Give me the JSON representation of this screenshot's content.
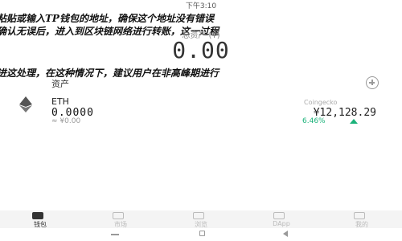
{
  "status_bar": {
    "time": "下午3:10"
  },
  "overlay_texts": [
    "粘贴或输入TP钱包的地址，确保这个地址没有错误",
    "确认无误后，进入到区块链网络进行转账，这一过程",
    "进这处理，在这种情况下，建议用户在非高峰期进行"
  ],
  "wallet": {
    "total_label": "总资产 (¥)",
    "total_amount": "0.00"
  },
  "assets": {
    "tab_label": "资产",
    "items": [
      {
        "symbol": "ETH",
        "amount": "0.0000",
        "value": "≈ ¥0.00",
        "source": "Coingecko",
        "price": "¥12,128.29",
        "change": "6.46%"
      }
    ]
  },
  "bottom_nav": [
    {
      "label": "钱包",
      "active": true
    },
    {
      "label": "市场",
      "active": false
    },
    {
      "label": "浏览",
      "active": false
    },
    {
      "label": "DApp",
      "active": false
    },
    {
      "label": "我的",
      "active": false
    }
  ],
  "colors": {
    "positive": "#1bb27a",
    "text": "#222222",
    "muted": "#999999"
  }
}
